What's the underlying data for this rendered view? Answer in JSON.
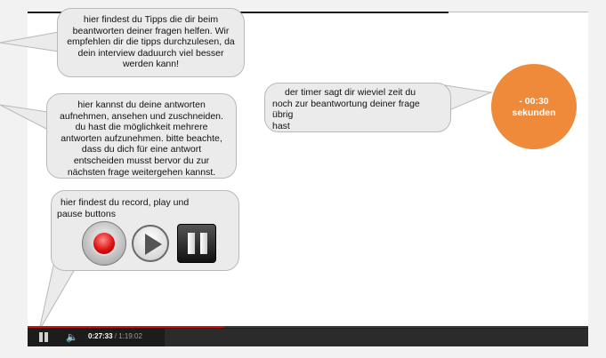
{
  "tips_bubble": {
    "lines": [
      "hier findest du Tipps die dir beim",
      "beantworten deiner fragen helfen. Wir",
      "empfehlen dir die tipps durchzulesen, da",
      "dein interview daduurch viel besser",
      "werden kann!"
    ]
  },
  "answers_bubble": {
    "lines": [
      "hier kannst du deine antworten",
      "aufnehmen, ansehen und zuschneiden.",
      "du hast die möglichkeit mehrere",
      "antworten aufzunehmen. bitte beachte,",
      "dass du dich für eine antwort",
      "entscheiden musst bervor du zur",
      "nächsten frage weitergehen kannst."
    ]
  },
  "timer_bubble": {
    "lines": [
      "der timer sagt dir wieviel zeit du",
      "noch zur beantwortung deiner frage übrig",
      "hast"
    ]
  },
  "controls_bubble": {
    "lines": [
      "hier findest du record, play und",
      "pause buttons"
    ]
  },
  "timer": {
    "value": "- 00:30",
    "unit": "sekunden",
    "color": "#ee8a3a"
  },
  "controls": {
    "record_icon": "record-icon",
    "play_icon": "play-icon",
    "pause_icon": "pause-icon"
  },
  "player": {
    "current_time": "0:27:33",
    "separator": " / ",
    "total_time": "1:19:02",
    "progress": 0.35,
    "accent": "#cc1111"
  }
}
